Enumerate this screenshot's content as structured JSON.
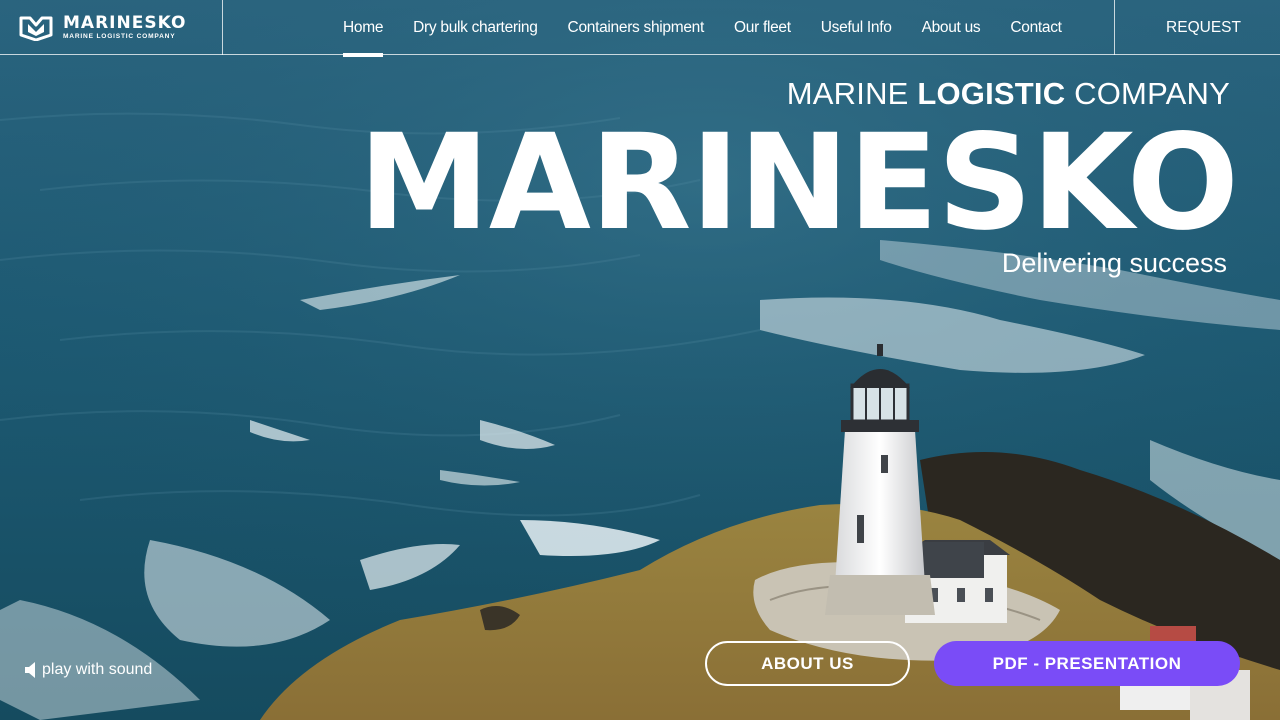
{
  "brand": {
    "name": "MARINESKO",
    "subtitle": "MARINE LOGISTIC COMPANY"
  },
  "nav": {
    "items": [
      {
        "label": "Home",
        "active": true
      },
      {
        "label": "Dry bulk chartering",
        "active": false
      },
      {
        "label": "Containers shipment",
        "active": false
      },
      {
        "label": "Our fleet",
        "active": false
      },
      {
        "label": "Useful Info",
        "active": false
      },
      {
        "label": "About us",
        "active": false
      },
      {
        "label": "Contact",
        "active": false
      }
    ],
    "request_label": "REQUEST"
  },
  "hero": {
    "tagline_pre": "MARINE ",
    "tagline_bold": "LOGISTIC",
    "tagline_post": " COMPANY",
    "title": "MARINESKO",
    "slogan": "Delivering success"
  },
  "controls": {
    "sound_label": "play with sound",
    "sound_icon": "speaker-icon",
    "about_button": "ABOUT US",
    "pdf_button": "PDF - PRESENTATION"
  },
  "colors": {
    "accent": "#7a4cf7",
    "sea": "#1f5a72"
  }
}
